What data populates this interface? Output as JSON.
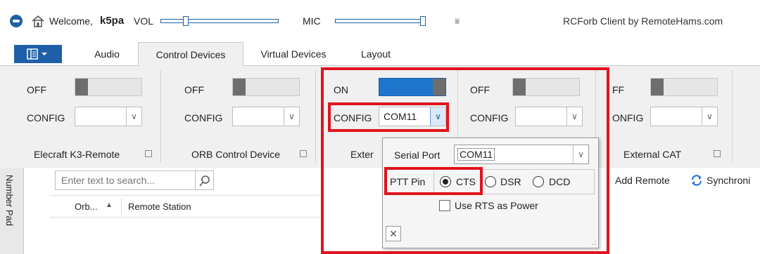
{
  "titlebar": {
    "welcome_prefix": "Welcome,",
    "username": "k5pa",
    "vol_label": "VOL",
    "mic_label": "MIC",
    "app_title": "RCForb Client by RemoteHams.com",
    "dropdown_glyph": "⩸"
  },
  "tabs": [
    {
      "label": "Audio"
    },
    {
      "label": "Control Devices",
      "active": true
    },
    {
      "label": "Virtual Devices"
    },
    {
      "label": "Layout"
    }
  ],
  "devices": [
    {
      "state": "OFF",
      "config_label": "CONFIG",
      "config_value": "",
      "group": "Elecraft K3-Remote"
    },
    {
      "state": "OFF",
      "config_label": "CONFIG",
      "config_value": "",
      "group": "ORB Control Device"
    },
    {
      "state": "ON",
      "config_label": "CONFIG",
      "config_value": "COM11",
      "group": "Exter"
    },
    {
      "state": "OFF",
      "config_label": "CONFIG",
      "config_value": "",
      "group": ""
    },
    {
      "state": "FF",
      "config_label": "ONFIG",
      "config_value": "",
      "group": "External CAT"
    }
  ],
  "search": {
    "placeholder": "Enter text to search..."
  },
  "side_tab": {
    "label": "Number Pad"
  },
  "grid": {
    "columns": [
      "Orb...",
      "Remote Station"
    ]
  },
  "toolbar": {
    "add_remote": "Add Remote",
    "synchronize": "Synchroni"
  },
  "popup": {
    "serial_port_label": "Serial Port",
    "serial_port_value": "COM11",
    "ptt_pin_label": "PTT Pin",
    "ptt_options": [
      "CTS",
      "DSR",
      "DCD"
    ],
    "ptt_selected": "CTS",
    "use_rts_label": "Use RTS as Power",
    "close_glyph": "✕"
  },
  "colors": {
    "accent": "#1f5fa8",
    "annotation": "#e0141e",
    "toggle_on": "#1f75cc"
  }
}
